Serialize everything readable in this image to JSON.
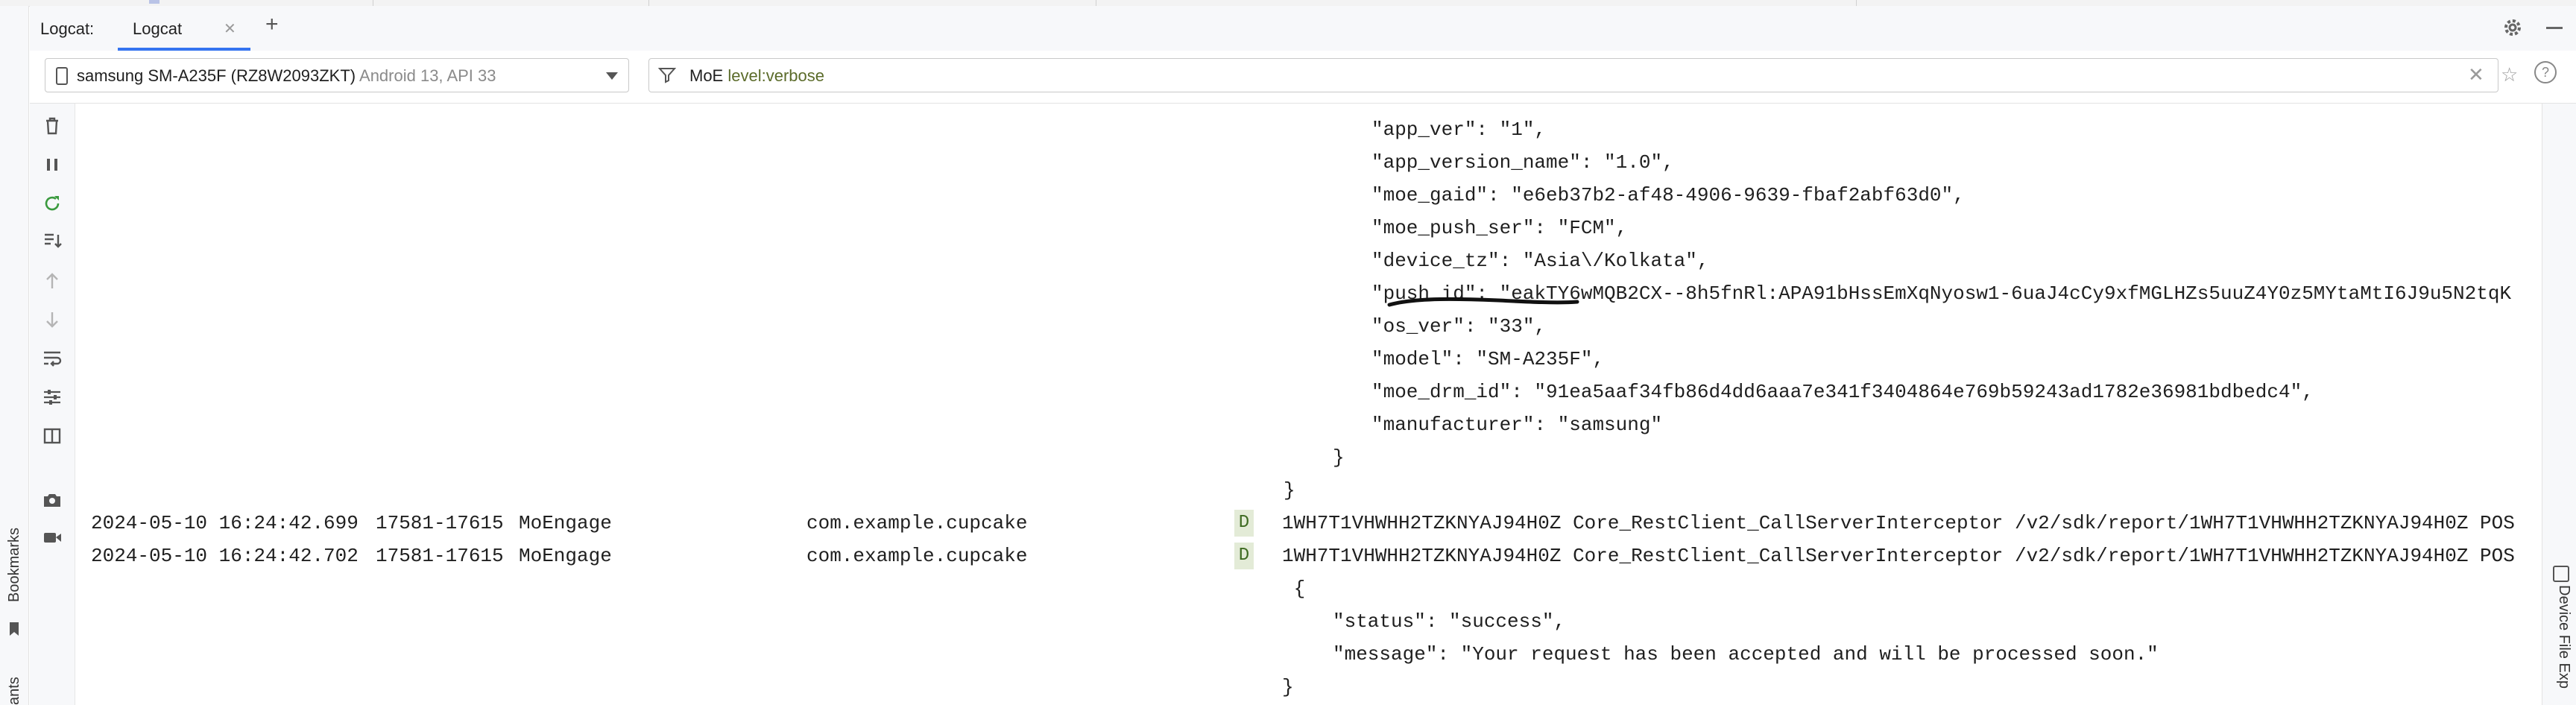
{
  "header": {
    "title": "Logcat:",
    "tabs": [
      {
        "label": "Logcat",
        "active": true
      }
    ]
  },
  "filter": {
    "device_name": "samsung SM-A235F (RZ8W2093ZKT)",
    "device_os": "Android 13, API 33",
    "query_text": "MoE",
    "query_key": "level:verbose"
  },
  "side_panels": {
    "left_labels": [
      "Bookmarks",
      "ants"
    ],
    "right_label": "Device File Exp"
  },
  "log_lines": [
    {
      "text": "\"app_ver\": \"1\",",
      "indent": 1738
    },
    {
      "text": "\"app_version_name\": \"1.0\",",
      "indent": 1738
    },
    {
      "text": "\"moe_gaid\": \"e6eb37b2-af48-4906-9639-fbaf2abf63d0\",",
      "indent": 1738
    },
    {
      "text": "\"moe_push_ser\": \"FCM\",",
      "indent": 1738
    },
    {
      "text": "\"device_tz\": \"Asia\\/Kolkata\",",
      "indent": 1738
    },
    {
      "text": "\"push_id\": \"eakTY6wMQB2CX--8h5fnRl:APA91bHssEmXqNyosw1-6uaJ4cCy9xfMGLHZs5uuZ4Y0z5MYtaMtI6J9u5N2tqK",
      "indent": 1738
    },
    {
      "text": "\"os_ver\": \"33\",",
      "indent": 1738
    },
    {
      "text": "\"model\": \"SM-A235F\",",
      "indent": 1738
    },
    {
      "text": "\"moe_drm_id\": \"91ea5aaf34fb86d4dd6aaa7e341f3404864e769b59243ad1782e36981bdbedc4\",",
      "indent": 1738
    },
    {
      "text": "\"manufacturer\": \"samsung\"",
      "indent": 1738
    },
    {
      "text": "}",
      "indent": 1686
    },
    {
      "text": "}",
      "indent": 1620
    }
  ],
  "log_entries": [
    {
      "timestamp": "2024-05-10 16:24:42.699",
      "pid": "17581-17615",
      "tag": "MoEngage",
      "package": "com.example.cupcake",
      "level": "D",
      "message": "1WH7T1VHWHH2TZKNYAJ94H0Z Core_RestClient_CallServerInterceptor /v2/sdk/report/1WH7T1VHWHH2TZKNYAJ94H0Z POS"
    },
    {
      "timestamp": "2024-05-10 16:24:42.702",
      "pid": "17581-17615",
      "tag": "MoEngage",
      "package": "com.example.cupcake",
      "level": "D",
      "message": "1WH7T1VHWHH2TZKNYAJ94H0Z Core_RestClient_CallServerInterceptor /v2/sdk/report/1WH7T1VHWHH2TZKNYAJ94H0Z POS"
    }
  ],
  "log_tail": [
    {
      "text": " {",
      "indent": 1618
    },
    {
      "text": "\"status\": \"success\",",
      "indent": 1686
    },
    {
      "text": "\"message\": \"Your request has been accepted and will be processed soon.\"",
      "indent": 1686
    },
    {
      "text": "}",
      "indent": 1618
    }
  ],
  "colors": {
    "tag": "#5b6b2a",
    "level_bg": "#e3ebd7",
    "accent": "#3574f0"
  },
  "icons": [
    "trash-icon",
    "pause-icon",
    "restart-icon",
    "scroll-to-end-icon",
    "up-arrow-icon",
    "down-arrow-icon",
    "soft-wrap-icon",
    "filter-settings-icon",
    "split-view-icon",
    "camera-icon",
    "video-icon"
  ]
}
